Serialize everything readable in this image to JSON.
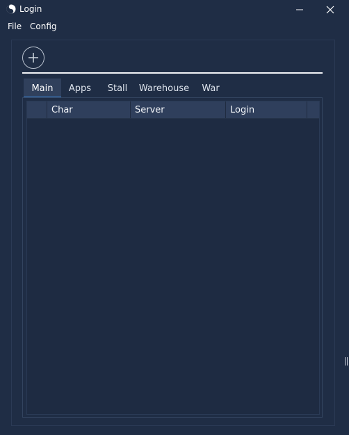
{
  "window": {
    "title": "Login",
    "icons": {
      "app": "yin-yang-icon",
      "minimize": "minimize-icon",
      "close": "close-icon"
    }
  },
  "menu": {
    "items": [
      {
        "label": "File"
      },
      {
        "label": "Config"
      }
    ]
  },
  "toolbar": {
    "add_icon": "plus-circle-icon"
  },
  "tabs": [
    {
      "label": "Main",
      "active": true
    },
    {
      "label": "Apps",
      "active": false
    },
    {
      "label": "Stall",
      "active": false
    },
    {
      "label": "Warehouse",
      "active": false
    },
    {
      "label": "War",
      "active": false
    }
  ],
  "grid": {
    "columns": [
      "",
      "Char",
      "Server",
      "Login",
      ""
    ],
    "rows": []
  },
  "colors": {
    "background": "#1f2d45",
    "header": "#2f3f5c",
    "active_tab_underline": "#3b86d8",
    "text": "#ffffff"
  }
}
